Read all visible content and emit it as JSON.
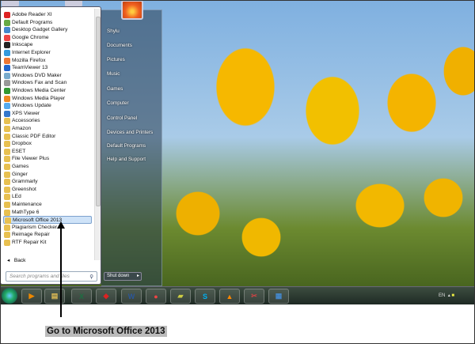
{
  "start_menu": {
    "programs": [
      {
        "label": "Adobe Reader XI",
        "icon": "adobe-icon",
        "color": "#d22"
      },
      {
        "label": "Default Programs",
        "icon": "default-programs-icon",
        "color": "#6a4"
      },
      {
        "label": "Desktop Gadget Gallery",
        "icon": "gadget-icon",
        "color": "#48c"
      },
      {
        "label": "Google Chrome",
        "icon": "chrome-icon",
        "color": "#e44"
      },
      {
        "label": "Inkscape",
        "icon": "inkscape-icon",
        "color": "#222"
      },
      {
        "label": "Internet Explorer",
        "icon": "ie-icon",
        "color": "#39d"
      },
      {
        "label": "Mozilla Firefox",
        "icon": "firefox-icon",
        "color": "#e73"
      },
      {
        "label": "TeamViewer 13",
        "icon": "teamviewer-icon",
        "color": "#26c"
      },
      {
        "label": "Windows DVD Maker",
        "icon": "dvd-icon",
        "color": "#7ac"
      },
      {
        "label": "Windows Fax and Scan",
        "icon": "fax-icon",
        "color": "#999"
      },
      {
        "label": "Windows Media Center",
        "icon": "media-center-icon",
        "color": "#393"
      },
      {
        "label": "Windows Media Player",
        "icon": "media-player-icon",
        "color": "#e82"
      },
      {
        "label": "Windows Update",
        "icon": "update-icon",
        "color": "#5ae"
      },
      {
        "label": "XPS Viewer",
        "icon": "xps-icon",
        "color": "#37c"
      },
      {
        "label": "Accessories",
        "icon": "folder-icon",
        "color": "#e8c050"
      },
      {
        "label": "Amazon",
        "icon": "folder-icon",
        "color": "#e8c050"
      },
      {
        "label": "Classic PDF Editor",
        "icon": "folder-icon",
        "color": "#e8c050"
      },
      {
        "label": "Dropbox",
        "icon": "folder-icon",
        "color": "#e8c050"
      },
      {
        "label": "ESET",
        "icon": "folder-icon",
        "color": "#e8c050"
      },
      {
        "label": "File Viewer Plus",
        "icon": "folder-icon",
        "color": "#e8c050"
      },
      {
        "label": "Games",
        "icon": "folder-icon",
        "color": "#e8c050"
      },
      {
        "label": "Ginger",
        "icon": "folder-icon",
        "color": "#e8c050"
      },
      {
        "label": "Grammarly",
        "icon": "folder-icon",
        "color": "#e8c050"
      },
      {
        "label": "Greenshot",
        "icon": "folder-icon",
        "color": "#e8c050"
      },
      {
        "label": "LEd",
        "icon": "folder-icon",
        "color": "#e8c050"
      },
      {
        "label": "Maintenance",
        "icon": "folder-icon",
        "color": "#e8c050"
      },
      {
        "label": "MathType 6",
        "icon": "folder-icon",
        "color": "#e8c050"
      },
      {
        "label": "Microsoft Office 2013",
        "icon": "folder-icon",
        "color": "#e8c050",
        "selected": true
      },
      {
        "label": "Plagiarism Checker X",
        "icon": "folder-icon",
        "color": "#e8c050"
      },
      {
        "label": "Reimage Repair",
        "icon": "folder-icon",
        "color": "#e8c050"
      },
      {
        "label": "RTF Repair Kit",
        "icon": "folder-icon",
        "color": "#e8c050"
      }
    ],
    "back_label": "Back",
    "search_placeholder": "Search programs and files",
    "right_items": [
      "Shylu",
      "Documents",
      "Pictures",
      "Music",
      "Games",
      "Computer",
      "Control Panel",
      "Devices and Printers",
      "Default Programs",
      "Help and Support"
    ],
    "shutdown_label": "Shut down"
  },
  "taskbar": {
    "apps": [
      {
        "name": "media-player-icon",
        "glyph": "▶",
        "color": "#e80"
      },
      {
        "name": "file-explorer-icon",
        "glyph": "▤",
        "color": "#db5"
      },
      {
        "name": "excel-icon",
        "glyph": "X",
        "color": "#1d6f42"
      },
      {
        "name": "red-app-icon",
        "glyph": "◆",
        "color": "#d22"
      },
      {
        "name": "word-icon",
        "glyph": "W",
        "color": "#2b579a"
      },
      {
        "name": "chrome-icon",
        "glyph": "●",
        "color": "#e44"
      },
      {
        "name": "sticky-notes-icon",
        "glyph": "▰",
        "color": "#cc4"
      },
      {
        "name": "skype-icon",
        "glyph": "S",
        "color": "#00aff0"
      },
      {
        "name": "vlc-icon",
        "glyph": "▲",
        "color": "#f80"
      },
      {
        "name": "snipping-tool-icon",
        "glyph": "✂",
        "color": "#c44"
      },
      {
        "name": "network-icon",
        "glyph": "▦",
        "color": "#48c"
      }
    ],
    "language": "EN"
  },
  "caption": "Go to Microsoft Office 2013"
}
